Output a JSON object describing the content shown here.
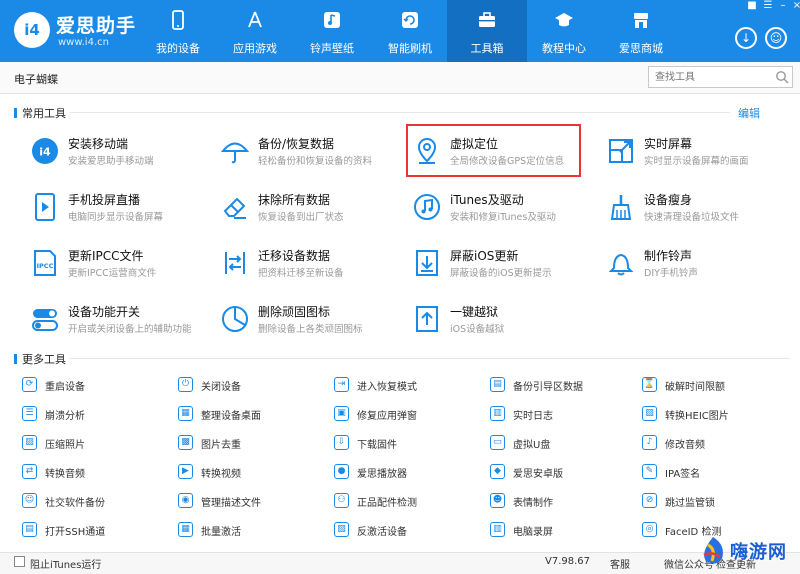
{
  "app": {
    "name": "爱思助手",
    "url": "www.i4.cn",
    "logo_text": "i4"
  },
  "colors": {
    "brand": "#1b8ae6",
    "active_nav": "#136fc2",
    "highlight": "#ee3333",
    "icon": "#1b8ae6"
  },
  "nav": [
    {
      "label": "我的设备",
      "icon": "phone-icon"
    },
    {
      "label": "应用游戏",
      "icon": "app-store-icon"
    },
    {
      "label": "铃声壁纸",
      "icon": "music-icon"
    },
    {
      "label": "智能刷机",
      "icon": "refresh-icon"
    },
    {
      "label": "工具箱",
      "icon": "toolbox-icon",
      "active": true
    },
    {
      "label": "教程中心",
      "icon": "graduation-cap-icon"
    },
    {
      "label": "爱思商城",
      "icon": "shop-icon"
    }
  ],
  "subbar": {
    "title": "电子蝴蝶",
    "search_placeholder": "查找工具"
  },
  "common_tools": {
    "title": "常用工具",
    "edit_label": "编辑",
    "items": [
      {
        "name": "安装移动端",
        "desc": "安装爱思助手移动端",
        "icon": "i4-app-icon"
      },
      {
        "name": "备份/恢复数据",
        "desc": "轻松备份和恢复设备的资料",
        "icon": "umbrella-icon"
      },
      {
        "name": "虚拟定位",
        "desc": "全局修改设备GPS定位信息",
        "icon": "location-pin-icon",
        "highlighted": true
      },
      {
        "name": "实时屏幕",
        "desc": "实时显示设备屏幕的画面",
        "icon": "screen-expand-icon"
      },
      {
        "name": "手机投屏直播",
        "desc": "电脑同步显示设备屏幕",
        "icon": "play-screen-icon"
      },
      {
        "name": "抹除所有数据",
        "desc": "恢复设备到出厂状态",
        "icon": "eraser-icon"
      },
      {
        "name": "iTunes及驱动",
        "desc": "安装和修复iTunes及驱动",
        "icon": "itunes-icon"
      },
      {
        "name": "设备瘦身",
        "desc": "快速清理设备垃圾文件",
        "icon": "broom-icon"
      },
      {
        "name": "更新IPCC文件",
        "desc": "更新IPCC运营商文件",
        "icon": "ipcc-file-icon"
      },
      {
        "name": "迁移设备数据",
        "desc": "把资料迁移至新设备",
        "icon": "transfer-icon"
      },
      {
        "name": "屏蔽iOS更新",
        "desc": "屏蔽设备的iOS更新提示",
        "icon": "block-update-icon"
      },
      {
        "name": "制作铃声",
        "desc": "DIY手机铃声",
        "icon": "bell-icon"
      },
      {
        "name": "设备功能开关",
        "desc": "开启或关闭设备上的辅助功能",
        "icon": "toggle-icon"
      },
      {
        "name": "删除顽固图标",
        "desc": "删除设备上各类顽固图标",
        "icon": "pie-icon"
      },
      {
        "name": "一键越狱",
        "desc": "iOS设备越狱",
        "icon": "jailbreak-icon"
      }
    ]
  },
  "more_tools": {
    "title": "更多工具",
    "items": [
      {
        "label": "重启设备",
        "icon": "restart-icon"
      },
      {
        "label": "关闭设备",
        "icon": "power-icon"
      },
      {
        "label": "进入恢复模式",
        "icon": "recovery-icon"
      },
      {
        "label": "备份引导区数据",
        "icon": "backup-boot-icon"
      },
      {
        "label": "破解时间限额",
        "icon": "hourglass-icon"
      },
      {
        "label": "崩溃分析",
        "icon": "crash-log-icon"
      },
      {
        "label": "整理设备桌面",
        "icon": "grid-icon"
      },
      {
        "label": "修复应用弹窗",
        "icon": "repair-popup-icon"
      },
      {
        "label": "实时日志",
        "icon": "log-icon"
      },
      {
        "label": "转换HEIC图片",
        "icon": "heic-icon"
      },
      {
        "label": "压缩照片",
        "icon": "compress-photo-icon"
      },
      {
        "label": "图片去重",
        "icon": "dedupe-photo-icon"
      },
      {
        "label": "下载固件",
        "icon": "download-firmware-icon"
      },
      {
        "label": "虚拟U盘",
        "icon": "usb-icon"
      },
      {
        "label": "修改音频",
        "icon": "edit-audio-icon"
      },
      {
        "label": "转换音频",
        "icon": "convert-audio-icon"
      },
      {
        "label": "转换视频",
        "icon": "convert-video-icon"
      },
      {
        "label": "爱思播放器",
        "icon": "player-icon"
      },
      {
        "label": "爱思安卓版",
        "icon": "android-icon"
      },
      {
        "label": "IPA签名",
        "icon": "ipa-sign-icon"
      },
      {
        "label": "社交软件备份",
        "icon": "social-backup-icon"
      },
      {
        "label": "管理描述文件",
        "icon": "profile-icon"
      },
      {
        "label": "正品配件检测",
        "icon": "accessory-check-icon"
      },
      {
        "label": "表情制作",
        "icon": "emoji-icon"
      },
      {
        "label": "跳过监管锁",
        "icon": "skip-lock-icon"
      },
      {
        "label": "打开SSH通道",
        "icon": "ssh-icon"
      },
      {
        "label": "批量激活",
        "icon": "batch-activate-icon"
      },
      {
        "label": "反激活设备",
        "icon": "deactivate-icon"
      },
      {
        "label": "电脑录屏",
        "icon": "record-screen-icon"
      },
      {
        "label": "FaceID 检测",
        "icon": "faceid-icon"
      }
    ]
  },
  "bottom": {
    "itunes_label": "阻止iTunes运行",
    "version": "V7.98.67",
    "service": "客服",
    "wechat": "微信公众号",
    "update": "检查更新"
  },
  "watermark": {
    "text": "嗨游网"
  }
}
